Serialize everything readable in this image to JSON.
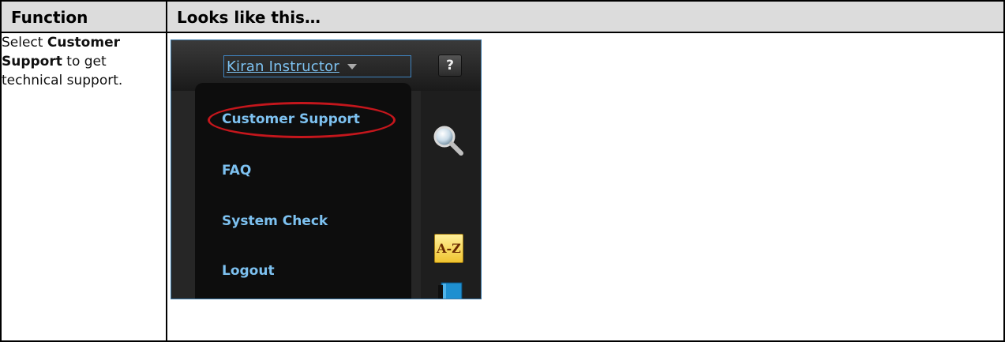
{
  "table": {
    "header_function": "Function",
    "header_looks": "Looks like this…"
  },
  "instruction": {
    "prefix": "Select ",
    "emphasis": "Customer Support",
    "suffix": " to get technical support."
  },
  "screenshot": {
    "user_menu": {
      "label": "Kiran Instructor"
    },
    "help_button": {
      "label": "?"
    },
    "menu_items": [
      "Customer Support",
      "FAQ",
      "System Check",
      "Logout"
    ],
    "highlighted_item": "Customer Support",
    "highlight_color": "#c4161c",
    "link_color": "#7dc1f0",
    "icons": [
      "magnifier-icon",
      "a-z-glossary-icon",
      "book-icon"
    ],
    "az_label": "A-Z"
  }
}
